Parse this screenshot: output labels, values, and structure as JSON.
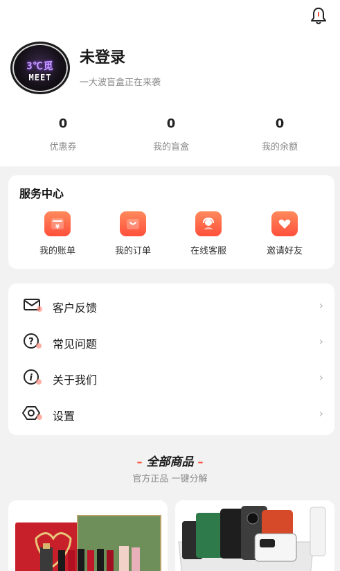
{
  "user": {
    "avatar_text_top": "3℃觅",
    "avatar_text_bottom": "MEET",
    "name": "未登录",
    "subtitle": "一大波盲盒正在来袭"
  },
  "stats": [
    {
      "value": "0",
      "label": "优惠券"
    },
    {
      "value": "0",
      "label": "我的盲盒"
    },
    {
      "value": "0",
      "label": "我的余额"
    }
  ],
  "service_center": {
    "title": "服务中心",
    "items": [
      {
        "label": "我的账单",
        "icon": "bill-icon"
      },
      {
        "label": "我的订单",
        "icon": "shopping-bag-icon"
      },
      {
        "label": "在线客服",
        "icon": "customer-service-icon"
      },
      {
        "label": "邀请好友",
        "icon": "gift-heart-icon"
      }
    ]
  },
  "menu": [
    {
      "label": "客户反馈",
      "icon": "mail-icon"
    },
    {
      "label": "常见问题",
      "icon": "question-icon"
    },
    {
      "label": "关于我们",
      "icon": "info-icon"
    },
    {
      "label": "设置",
      "icon": "settings-icon"
    }
  ],
  "products_section": {
    "title": "全部商品",
    "subtitle": "官方正品 一键分解"
  },
  "colors": {
    "accent": "#ff4f3b",
    "background": "#f2f2f3"
  }
}
